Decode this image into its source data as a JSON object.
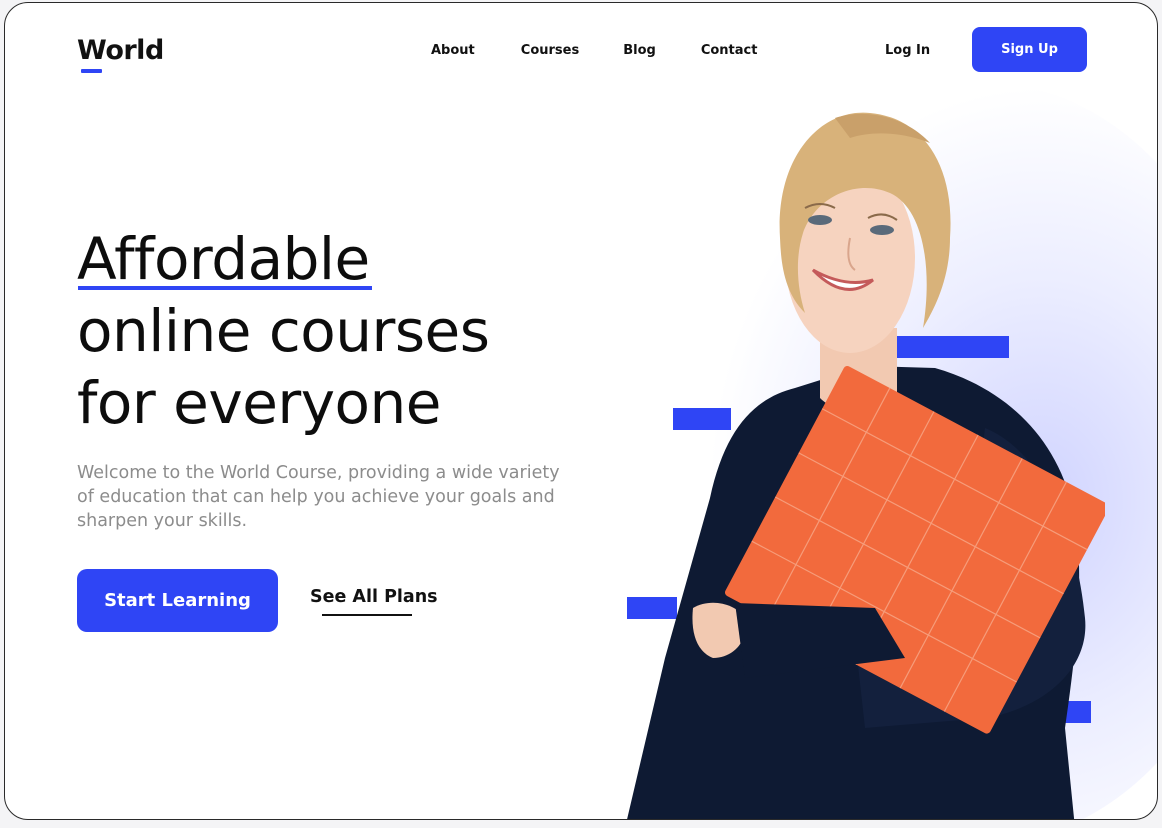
{
  "brand": {
    "name": "World",
    "accent": "#2f45f5"
  },
  "nav": {
    "links": [
      "About",
      "Courses",
      "Blog",
      "Contact"
    ],
    "login": "Log In",
    "signup": "Sign Up"
  },
  "hero": {
    "headline": [
      "Affordable",
      "online courses",
      "for everyone"
    ],
    "description": "Welcome to the World Course, providing a wide variety of education that can help you achieve your goals and sharpen your skills.",
    "primary_cta": "Start Learning",
    "secondary_cta": "See All Plans"
  },
  "image": {
    "subject": "smiling woman holding an orange folder",
    "sweater_color": "#0e1a33",
    "folder_color": "#f26a3d"
  }
}
